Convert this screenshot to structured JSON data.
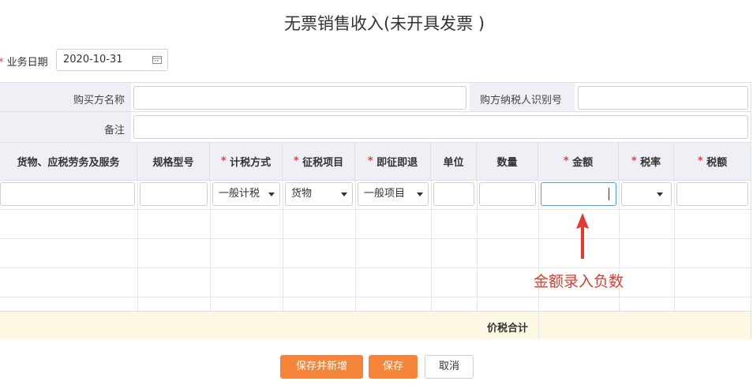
{
  "page": {
    "title": "无票销售收入(未开具发票 )"
  },
  "business_date": {
    "label": "业务日期",
    "value": "2020-10-31",
    "required_mark": "*"
  },
  "buyer": {
    "name_label": "购买方名称",
    "name_value": "",
    "tax_id_label": "购方纳税人识别号",
    "tax_id_value": ""
  },
  "remark": {
    "label": "备注",
    "value": ""
  },
  "columns": [
    {
      "label": "货物、应税劳务及服务",
      "required": ""
    },
    {
      "label": "规格型号",
      "required": ""
    },
    {
      "label": "计税方式",
      "required": "*"
    },
    {
      "label": "征税项目",
      "required": "*"
    },
    {
      "label": "即征即退",
      "required": "*"
    },
    {
      "label": "单位",
      "required": ""
    },
    {
      "label": "数量",
      "required": ""
    },
    {
      "label": "金额",
      "required": "*"
    },
    {
      "label": "税率",
      "required": "*"
    },
    {
      "label": "税额",
      "required": "*"
    }
  ],
  "row": {
    "tax_method": "一般计税",
    "tax_item": "货物",
    "instant_refund": "一般项目",
    "tax_rate": ""
  },
  "total": {
    "label": "价税合计",
    "value": ""
  },
  "annotation": {
    "text": "金额录入负数",
    "color": "#e23b2e"
  },
  "buttons": {
    "save_and_new": "保存并新增",
    "save": "保存",
    "cancel": "取消"
  },
  "colors": {
    "accent": "#f5853a",
    "header_bg": "#eef0f5",
    "total_bg": "#fdf8e4"
  }
}
